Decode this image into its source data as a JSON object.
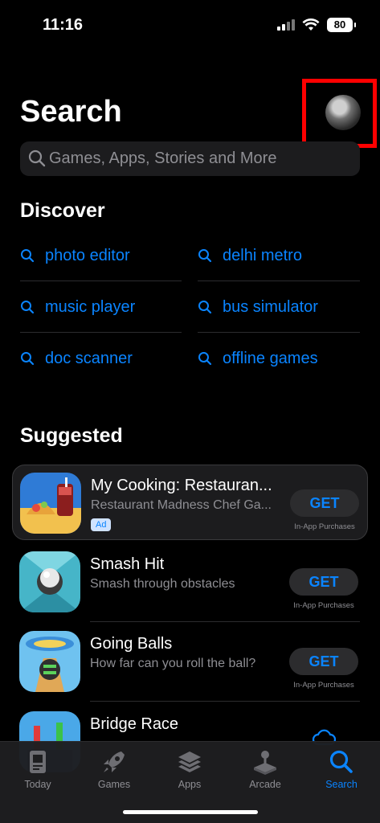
{
  "status": {
    "time": "11:16",
    "battery": "80"
  },
  "header": {
    "title": "Search"
  },
  "search": {
    "placeholder": "Games, Apps, Stories and More"
  },
  "discover": {
    "title": "Discover",
    "items": [
      {
        "label": "photo editor"
      },
      {
        "label": "delhi metro"
      },
      {
        "label": "music player"
      },
      {
        "label": "bus simulator"
      },
      {
        "label": "doc scanner"
      },
      {
        "label": "offline games"
      }
    ]
  },
  "suggested": {
    "title": "Suggested",
    "apps": [
      {
        "name": "My Cooking: Restauran...",
        "subtitle": "Restaurant Madness Chef Ga...",
        "badge": "Ad",
        "button": "GET",
        "note": "In-App Purchases"
      },
      {
        "name": "Smash Hit",
        "subtitle": "Smash through obstacles",
        "button": "GET",
        "note": "In-App Purchases"
      },
      {
        "name": "Going Balls",
        "subtitle": "How far can you roll the ball?",
        "button": "GET",
        "note": "In-App Purchases"
      },
      {
        "name": "Bridge Race"
      }
    ]
  },
  "tabbar": {
    "tabs": [
      {
        "label": "Today",
        "icon": "today-icon"
      },
      {
        "label": "Games",
        "icon": "rocket-icon"
      },
      {
        "label": "Apps",
        "icon": "layers-icon"
      },
      {
        "label": "Arcade",
        "icon": "joystick-icon"
      },
      {
        "label": "Search",
        "icon": "search-icon",
        "active": true
      }
    ]
  },
  "colors": {
    "accent": "#0a84ff",
    "background": "#000000",
    "highlight": "#ff0000"
  }
}
